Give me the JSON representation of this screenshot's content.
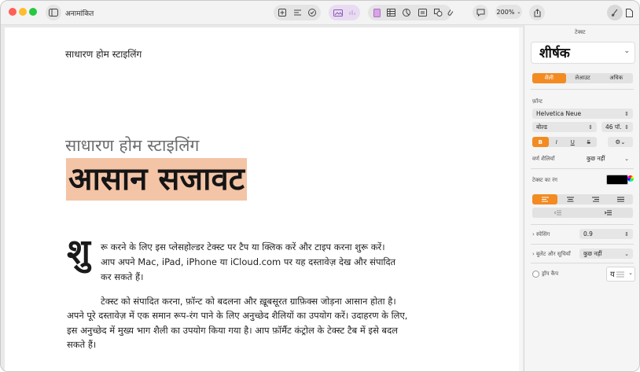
{
  "window": {
    "title": "अनामांकित"
  },
  "toolbar": {
    "zoom": "200%"
  },
  "document": {
    "header": "साधारण होम स्टाइलिंग",
    "subtitle": "साधारण होम स्टाइलिंग",
    "title": "आसान सजावट",
    "dropcap": "शु",
    "para1": [
      "रू करने के लिए इस प्लेसहोल्डर टेक्स्ट पर टैप या क्लिक करें और टाइप करना शुरू करें।",
      "आप अपने Mac, iPad, iPhone या iCloud.com पर यह दस्तावेज़ देख और संपादित",
      "कर सकते हैं।"
    ],
    "para2": [
      "टेक्स्ट को संपादित करना, फ़ॉन्ट को बदलना और ख़ूबसूरत ग्राफ़िक्स जोड़ना आसान होता है।",
      "अपने पूरे दस्तावेज़ में एक समान रूप-रंग पाने के लिए अनुच्छेद शैलियों का उपयोग करें। उदाहरण के लिए,",
      "इस अनुच्छेद में मुख्य भाग शैली का उपयोग किया गया है। आप फ़ॉर्मैट कंट्रोल के टेक्स्ट टैब में इसे बदल",
      "सकते हैं।"
    ]
  },
  "sidebar": {
    "section": "टेक्स्ट",
    "style_name": "शीर्षक",
    "tabs": [
      "शैली",
      "लेआउट",
      "अधिक"
    ],
    "font_label": "फ़ॉन्ट",
    "font": "Helvetica Neue",
    "weight": "बोल्ड",
    "size": "46 पॉ.",
    "format_buttons": [
      "B",
      "I",
      "U",
      "S"
    ],
    "char_styles_label": "वर्ण शैलियाँ",
    "char_styles_value": "कुछ नहीं",
    "text_color_label": "टेक्स्ट का रंग",
    "spacing_label": "स्पेसिंग",
    "spacing_value": "0.9",
    "bullets_label": "बुलेट और सूचियाँ",
    "bullets_value": "कुछ नहीं",
    "dropcap_label": "ड्रॉप कैप",
    "dropcap_preview": "य"
  },
  "colors": {
    "accent": "#f28b22",
    "highlight": "#f3c4a6"
  }
}
